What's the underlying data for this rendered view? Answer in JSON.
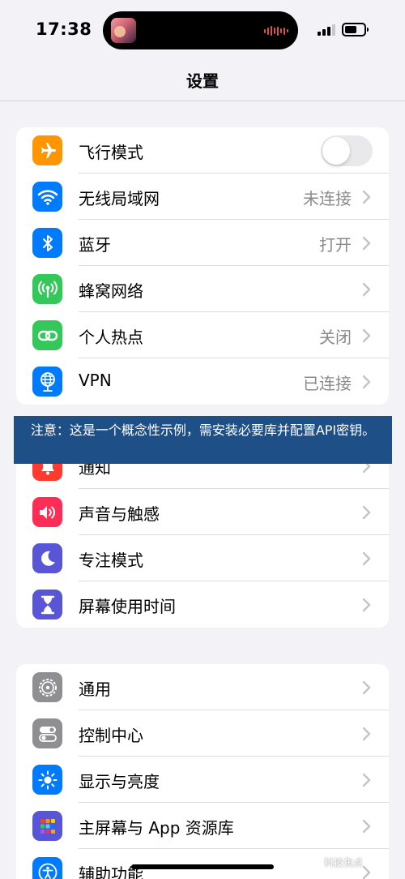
{
  "status_bar": {
    "time": "17:38"
  },
  "nav": {
    "title": "设置"
  },
  "group1": [
    {
      "label": "飞行模式",
      "value": "",
      "type": "toggle",
      "toggle_on": false,
      "color": "#ff9500",
      "icon": "airplane-icon"
    },
    {
      "label": "无线局域网",
      "value": "未连接",
      "color": "#007aff",
      "icon": "wifi-icon"
    },
    {
      "label": "蓝牙",
      "value": "打开",
      "color": "#007aff",
      "icon": "bluetooth-icon"
    },
    {
      "label": "蜂窝网络",
      "value": "",
      "color": "#34c759",
      "icon": "cellular-icon"
    },
    {
      "label": "个人热点",
      "value": "关闭",
      "color": "#34c759",
      "icon": "hotspot-icon"
    },
    {
      "label": "VPN",
      "value": "已连接",
      "color": "#007aff",
      "icon": "vpn-globe-icon"
    }
  ],
  "banner": {
    "text": "注意：这是一个概念性示例，需安装必要库并配置API密钥。"
  },
  "group2": [
    {
      "label": "通知",
      "color": "#ff3b30",
      "icon": "bell-icon"
    },
    {
      "label": "声音与触感",
      "color": "#ff2d55",
      "icon": "speaker-icon"
    },
    {
      "label": "专注模式",
      "color": "#5856d6",
      "icon": "moon-icon"
    },
    {
      "label": "屏幕使用时间",
      "color": "#5856d6",
      "icon": "hourglass-icon"
    }
  ],
  "group3": [
    {
      "label": "通用",
      "color": "#8e8e93",
      "icon": "gear-icon"
    },
    {
      "label": "控制中心",
      "color": "#8e8e93",
      "icon": "switches-icon"
    },
    {
      "label": "显示与亮度",
      "color": "#007aff",
      "icon": "sun-icon"
    },
    {
      "label": "主屏幕与 App 资源库",
      "color": "#5856d6",
      "icon": "app-grid-icon"
    },
    {
      "label": "辅助功能",
      "color": "#007aff",
      "icon": "accessibility-icon"
    }
  ],
  "watermark": "科技焦点"
}
